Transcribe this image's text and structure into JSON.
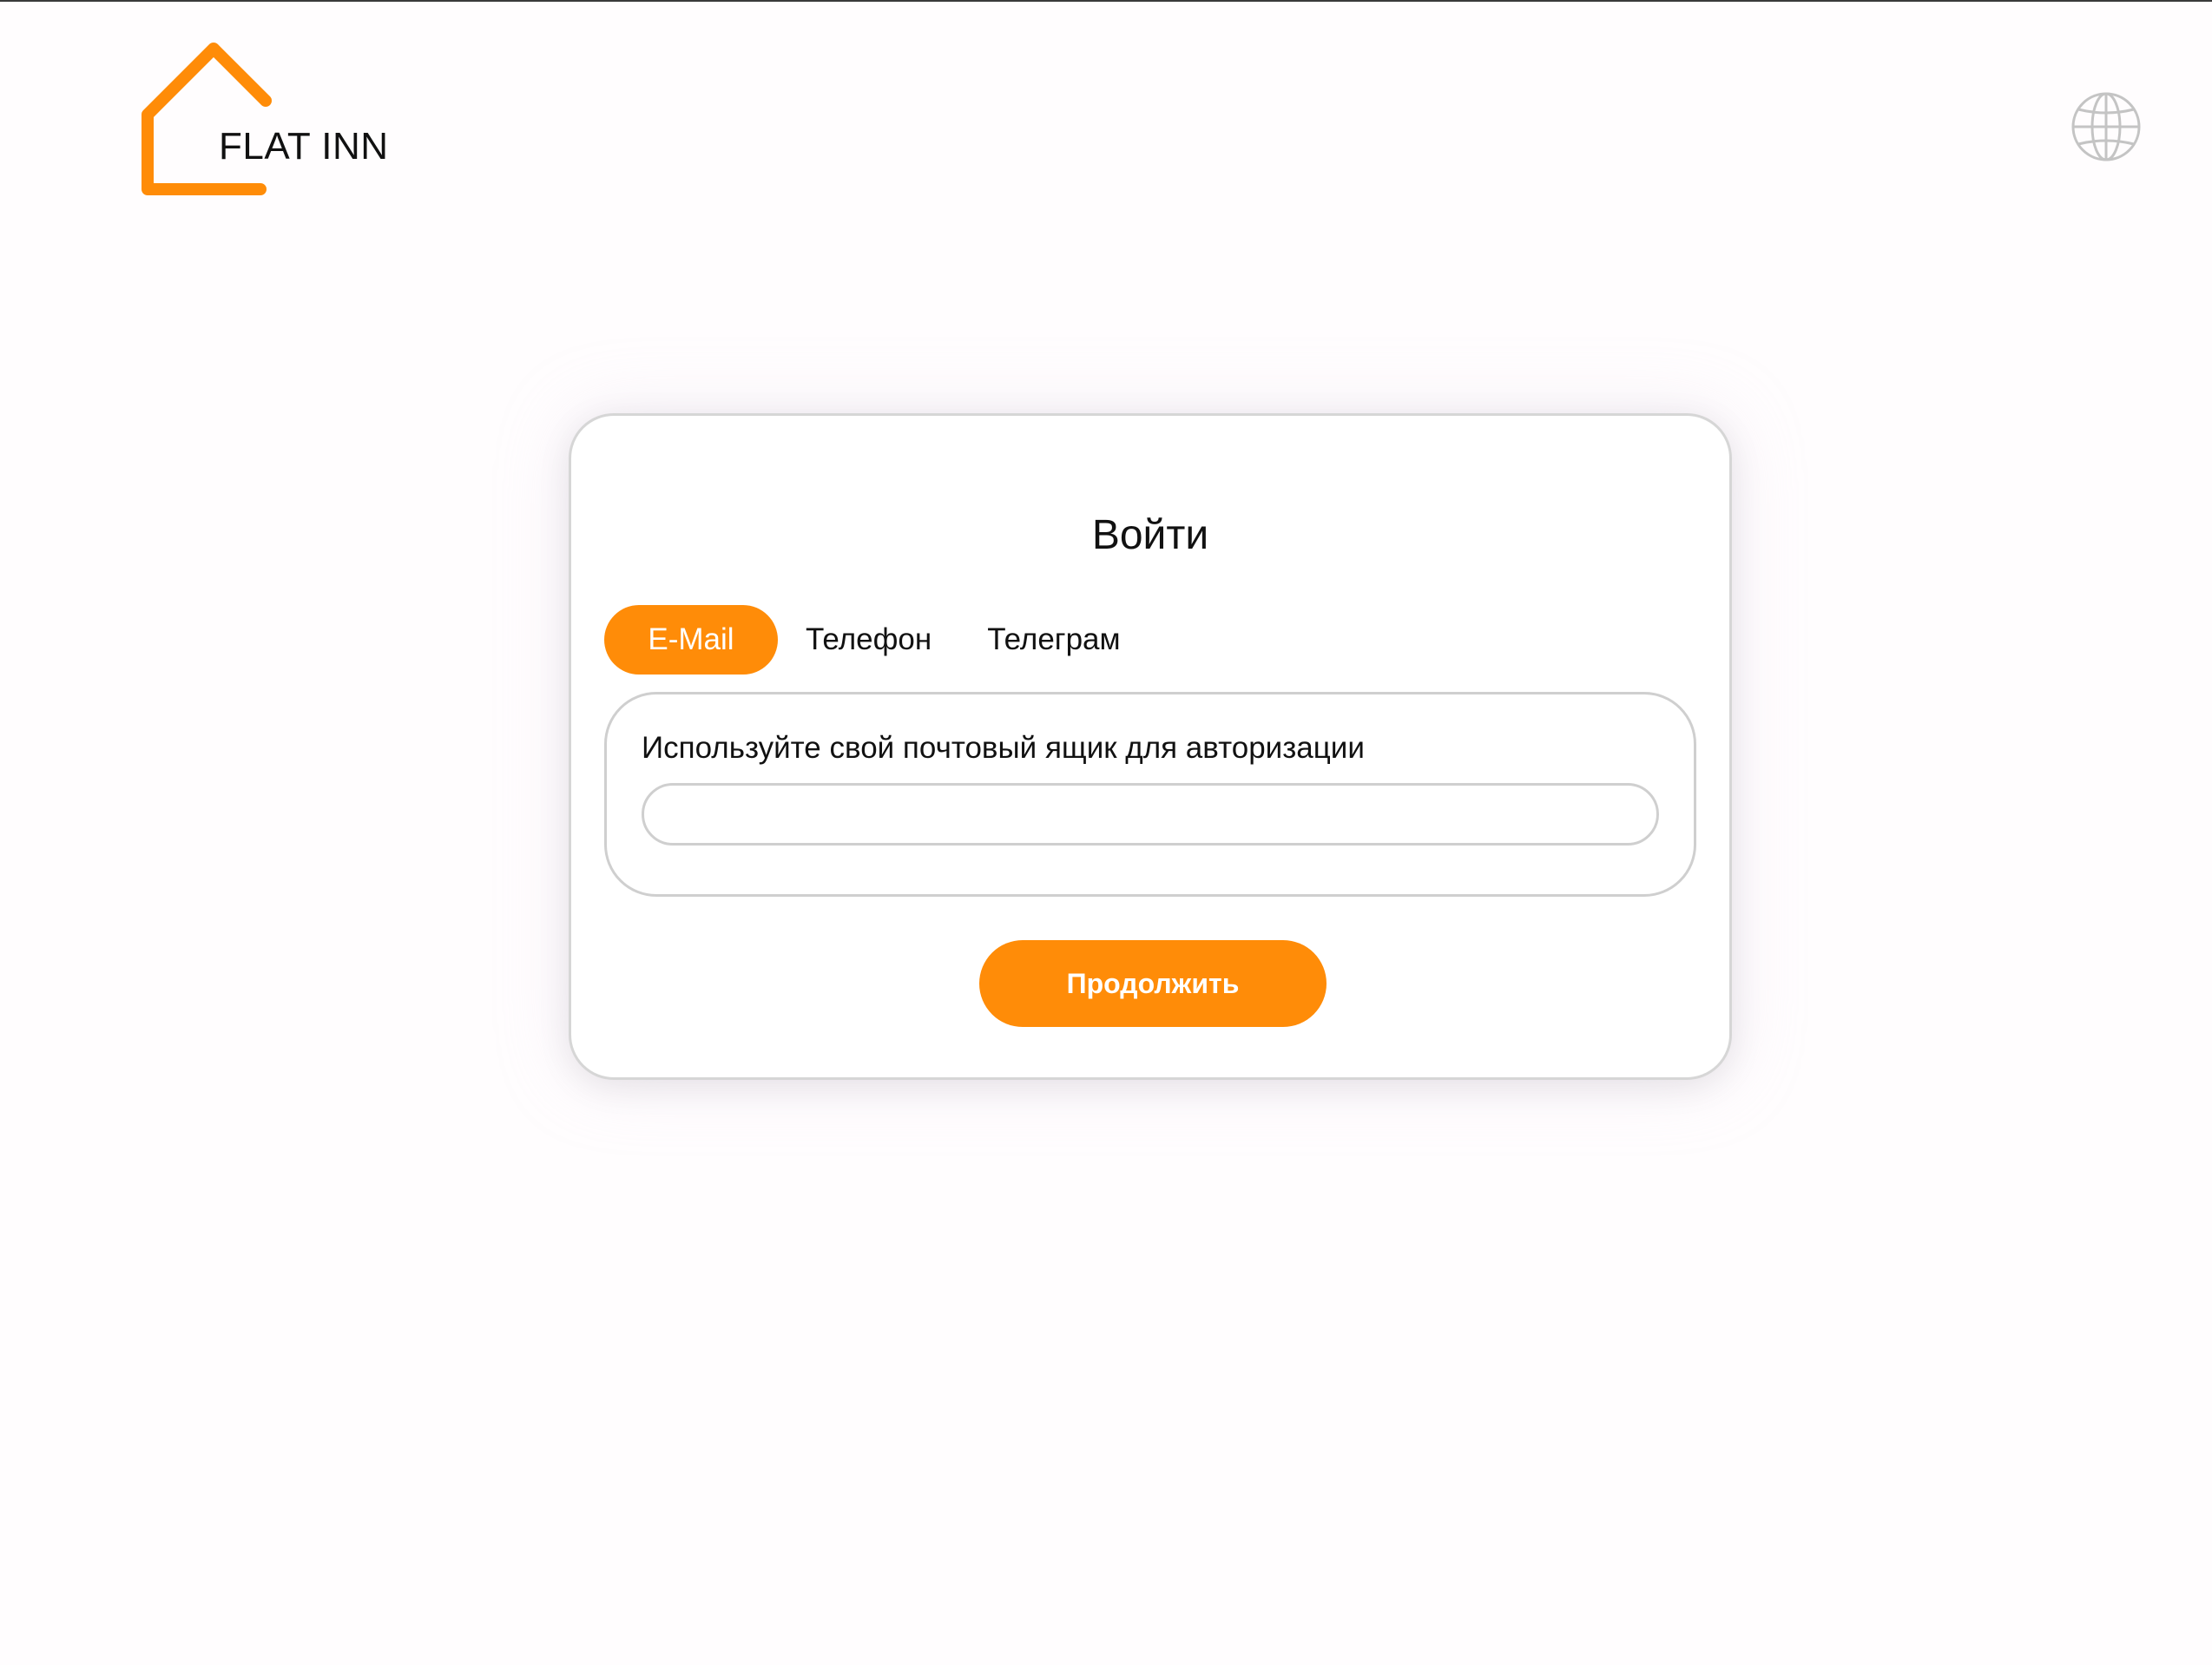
{
  "header": {
    "logo_text": "FLAT INN",
    "language_icon": "globe-icon"
  },
  "login": {
    "title": "Войти",
    "tabs": [
      {
        "label": "E-Mail",
        "active": true
      },
      {
        "label": "Телефон",
        "active": false
      },
      {
        "label": "Телеграм",
        "active": false
      }
    ],
    "email": {
      "label": "Используйте свой почтовый ящик для авторизации",
      "value": "",
      "placeholder": ""
    },
    "continue_label": "Продолжить"
  },
  "colors": {
    "accent": "#ff8c08",
    "border": "#cfcfcf",
    "background": "#fffdfe",
    "text": "#111111"
  }
}
